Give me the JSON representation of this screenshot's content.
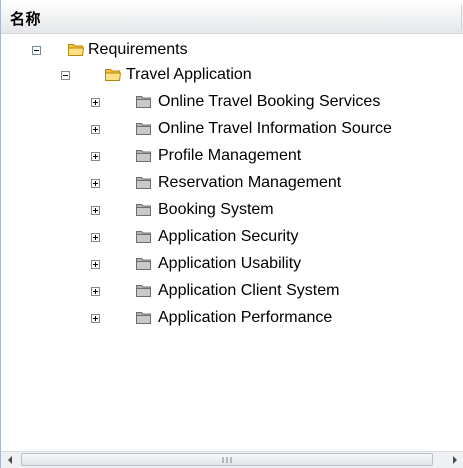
{
  "header": {
    "title": "名称"
  },
  "tree": {
    "root": {
      "label": "Requirements",
      "expanded": true,
      "icon": "folder-open-icon"
    },
    "app": {
      "label": "Travel Application",
      "expanded": true,
      "icon": "folder-open-icon"
    },
    "children": [
      {
        "label": "Online Travel Booking Services",
        "icon": "folder-closed-gray-icon"
      },
      {
        "label": "Online Travel Information Source",
        "icon": "folder-closed-gray-icon"
      },
      {
        "label": "Profile Management",
        "icon": "folder-closed-gray-icon"
      },
      {
        "label": "Reservation Management",
        "icon": "folder-closed-gray-icon"
      },
      {
        "label": "Booking System",
        "icon": "folder-closed-gray-icon"
      },
      {
        "label": "Application Security",
        "icon": "folder-closed-gray-icon"
      },
      {
        "label": "Application Usability",
        "icon": "folder-closed-gray-icon"
      },
      {
        "label": "Application Client System",
        "icon": "folder-closed-gray-icon"
      },
      {
        "label": "Application Performance",
        "icon": "folder-closed-gray-icon"
      }
    ]
  },
  "colors": {
    "folder_open": "#f5c542",
    "folder_closed": "#a8a8a8",
    "header_bg": "#eef0f2"
  }
}
